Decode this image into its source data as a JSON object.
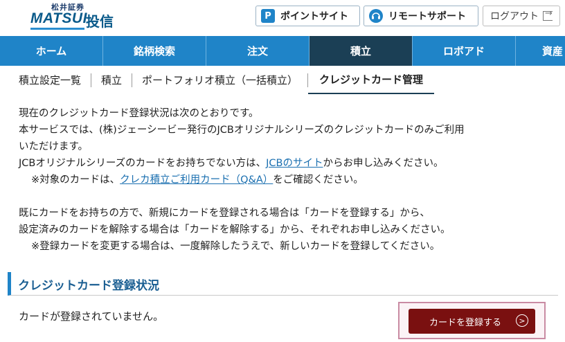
{
  "header": {
    "logo_small": "松井証券",
    "logo_brand": "MATSUI",
    "logo_sub": "投信",
    "point_icon": "P",
    "point_label": "ポイントサイト",
    "remote_label": "リモートサポート",
    "logout_label": "ログアウト"
  },
  "icons": {
    "point": "point-icon",
    "remote": "headset-icon",
    "logout": "logout-icon",
    "chevron": "chevron-right-circle-icon"
  },
  "gnav": [
    "ホーム",
    "銘柄検索",
    "注文",
    "積立",
    "ロボアド",
    "資産"
  ],
  "gnav_active": "積立",
  "subnav": [
    "積立設定一覧",
    "積立",
    "ポートフォリオ積立（一括積立）",
    "クレジットカード管理"
  ],
  "subnav_active": "クレジットカード管理",
  "body": {
    "line1": "現在のクレジットカード登録状況は次のとおりです。",
    "line2": "本サービスでは、(株)ジェーシービー発行のJCBオリジナルシリーズのクレジットカードのみご利用",
    "line3": "いただけます。",
    "line4_pre": "JCBオリジナルシリーズのカードをお持ちでない方は、",
    "line4_link": "JCBのサイト",
    "line4_post": "からお申し込みください。",
    "line5_pre": "※対象のカードは、",
    "line5_link": "クレカ積立ご利用カード（Q&A）",
    "line5_post": "をご確認ください。",
    "line6": "既にカードをお持ちの方で、新規にカードを登録される場合は「カードを登録する」から、",
    "line7": "設定済みのカードを解除する場合は「カードを解除する」から、それぞれお申し込みください。",
    "line8": "※登録カードを変更する場合は、一度解除したうえで、新しいカードを登録してください。"
  },
  "section_title": "クレジットカード登録状況",
  "status_text": "カードが登録されていません。",
  "register_button": "カードを登録する",
  "colors": {
    "brand_blue": "#1f84c8",
    "nav_active": "#1b3f55",
    "link": "#1a6fb0",
    "register_btn": "#7a1010",
    "highlight_frame": "#c98ba3"
  }
}
